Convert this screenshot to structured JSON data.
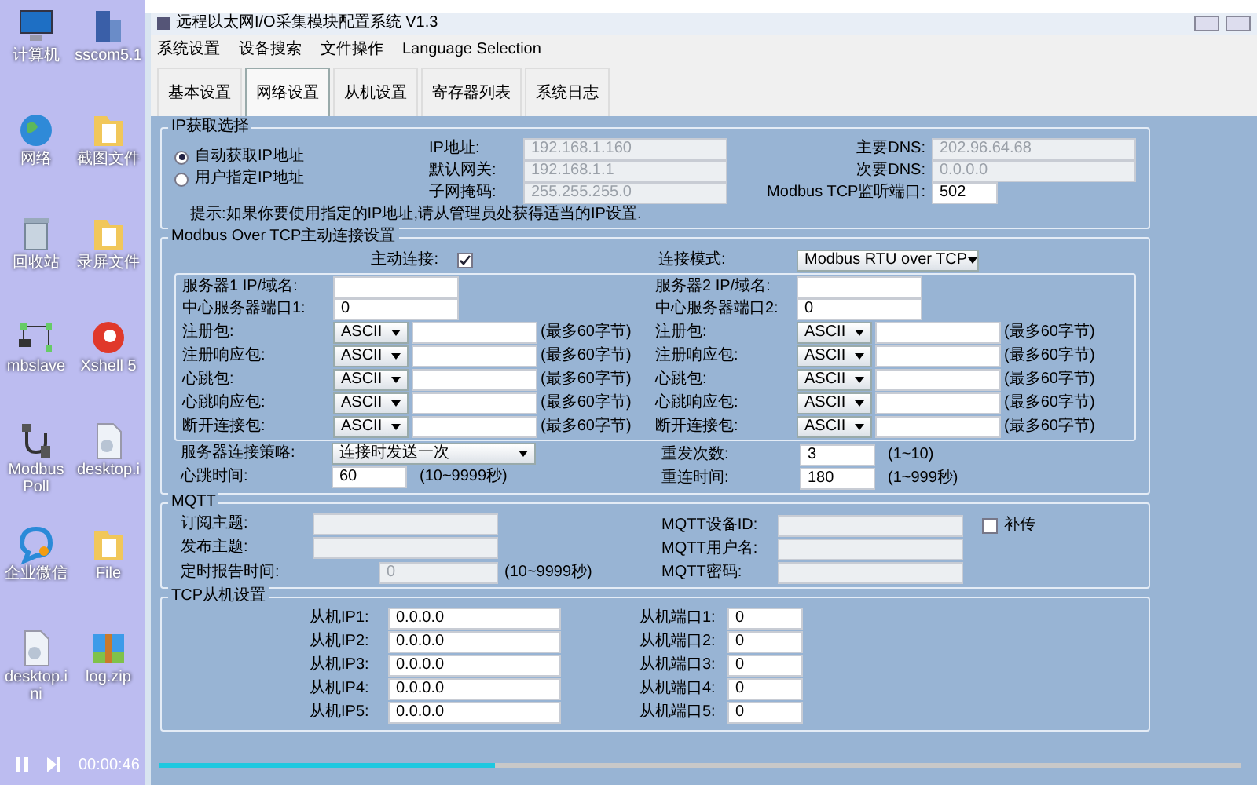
{
  "desktop_icons": [
    {
      "label": "计算机",
      "kind": "computer"
    },
    {
      "label": "sscom5.1",
      "kind": "app"
    },
    {
      "label": "网络",
      "kind": "globe"
    },
    {
      "label": "截图文件",
      "kind": "folder"
    },
    {
      "label": "回收站",
      "kind": "trash"
    },
    {
      "label": "录屏文件",
      "kind": "folder"
    },
    {
      "label": "mbslave",
      "kind": "network"
    },
    {
      "label": "Xshell 5",
      "kind": "shell"
    },
    {
      "label": "Modbus Poll",
      "kind": "cable"
    },
    {
      "label": "desktop.i",
      "kind": "file"
    },
    {
      "label": "企业微信",
      "kind": "chat"
    },
    {
      "label": "File",
      "kind": "folder"
    },
    {
      "label": "desktop.ini",
      "kind": "file"
    },
    {
      "label": "log.zip",
      "kind": "zip"
    }
  ],
  "window": {
    "title": "远程以太网I/O采集模块配置系统 V1.3"
  },
  "menu": [
    "系统设置",
    "设备搜索",
    "文件操作",
    "Language Selection"
  ],
  "tabs": [
    {
      "label": "基本设置",
      "selected": false
    },
    {
      "label": "网络设置",
      "selected": true
    },
    {
      "label": "从机设置",
      "selected": false
    },
    {
      "label": "寄存器列表",
      "selected": false
    },
    {
      "label": "系统日志",
      "selected": false
    }
  ],
  "ip_section": {
    "legend": "IP获取选择",
    "radios": [
      {
        "label": "自动获取IP地址",
        "selected": true
      },
      {
        "label": "用户指定IP地址",
        "selected": false
      }
    ],
    "left_fields": [
      {
        "label": "IP地址:",
        "value": "192.168.1.160",
        "disabled": true
      },
      {
        "label": "默认网关:",
        "value": "192.168.1.1",
        "disabled": true
      },
      {
        "label": "子网掩码:",
        "value": "255.255.255.0",
        "disabled": true
      }
    ],
    "right_fields": [
      {
        "label": "主要DNS:",
        "value": "202.96.64.68",
        "disabled": true
      },
      {
        "label": "次要DNS:",
        "value": "0.0.0.0",
        "disabled": true
      },
      {
        "label": "Modbus TCP监听端口:",
        "value": "502",
        "disabled": false
      }
    ],
    "hint": "提示:如果你要使用指定的IP地址,请从管理员处获得适当的IP设置."
  },
  "modbus_section": {
    "legend": "Modbus Over TCP主动连接设置",
    "active_connect": {
      "label": "主动连接:",
      "checked": true
    },
    "mode": {
      "label": "连接模式:",
      "value": "Modbus RTU over TCP"
    },
    "servers": [
      {
        "ip": {
          "label": "服务器1 IP/域名:"
        },
        "port": {
          "label": "中心服务器端口1:",
          "value": "0"
        },
        "packets": [
          {
            "label": "注册包:",
            "encoding": "ASCII",
            "note": "(最多60字节)"
          },
          {
            "label": "注册响应包:",
            "encoding": "ASCII",
            "note": "(最多60字节)"
          },
          {
            "label": "心跳包:",
            "encoding": "ASCII",
            "note": "(最多60字节)"
          },
          {
            "label": "心跳响应包:",
            "encoding": "ASCII",
            "note": "(最多60字节)"
          },
          {
            "label": "断开连接包:",
            "encoding": "ASCII",
            "note": "(最多60字节)"
          }
        ]
      },
      {
        "ip": {
          "label": "服务器2 IP/域名:"
        },
        "port": {
          "label": "中心服务器端口2:",
          "value": "0"
        },
        "packets": [
          {
            "label": "注册包:",
            "encoding": "ASCII",
            "note": "(最多60字节)"
          },
          {
            "label": "注册响应包:",
            "encoding": "ASCII",
            "note": "(最多60字节)"
          },
          {
            "label": "心跳包:",
            "encoding": "ASCII",
            "note": "(最多60字节)"
          },
          {
            "label": "心跳响应包:",
            "encoding": "ASCII",
            "note": "(最多60字节)"
          },
          {
            "label": "断开连接包:",
            "encoding": "ASCII",
            "note": "(最多60字节)"
          }
        ]
      }
    ],
    "strategy": {
      "label": "服务器连接策略:",
      "value": "连接时发送一次"
    },
    "heartbeat": {
      "label": "心跳时间:",
      "value": "60",
      "note": "(10~9999秒)"
    },
    "retry": {
      "label": "重发次数:",
      "value": "3",
      "note": "(1~10)"
    },
    "reconnect": {
      "label": "重连时间:",
      "value": "180",
      "note": "(1~999秒)"
    }
  },
  "mqtt_section": {
    "legend": "MQTT",
    "left_fields": [
      {
        "label": "订阅主题:",
        "disabled": true
      },
      {
        "label": "发布主题:",
        "disabled": true
      },
      {
        "label": "定时报告时间:",
        "value": "0",
        "note": "(10~9999秒)",
        "disabled": true
      }
    ],
    "right_fields": [
      {
        "label": "MQTT设备ID:",
        "disabled": true
      },
      {
        "label": "MQTT用户名:",
        "disabled": true
      },
      {
        "label": "MQTT密码:",
        "disabled": true
      }
    ],
    "resend": {
      "label": "补传",
      "checked": false
    }
  },
  "tcp_section": {
    "legend": "TCP从机设置",
    "rows": [
      {
        "ip_label": "从机IP1:",
        "ip": "0.0.0.0",
        "port_label": "从机端口1:",
        "port": "0"
      },
      {
        "ip_label": "从机IP2:",
        "ip": "0.0.0.0",
        "port_label": "从机端口2:",
        "port": "0"
      },
      {
        "ip_label": "从机IP3:",
        "ip": "0.0.0.0",
        "port_label": "从机端口3:",
        "port": "0"
      },
      {
        "ip_label": "从机IP4:",
        "ip": "0.0.0.0",
        "port_label": "从机端口4:",
        "port": "0"
      },
      {
        "ip_label": "从机IP5:",
        "ip": "0.0.0.0",
        "port_label": "从机端口5:",
        "port": "0"
      }
    ]
  },
  "player": {
    "time": "00:00:46",
    "level": 0.31
  }
}
